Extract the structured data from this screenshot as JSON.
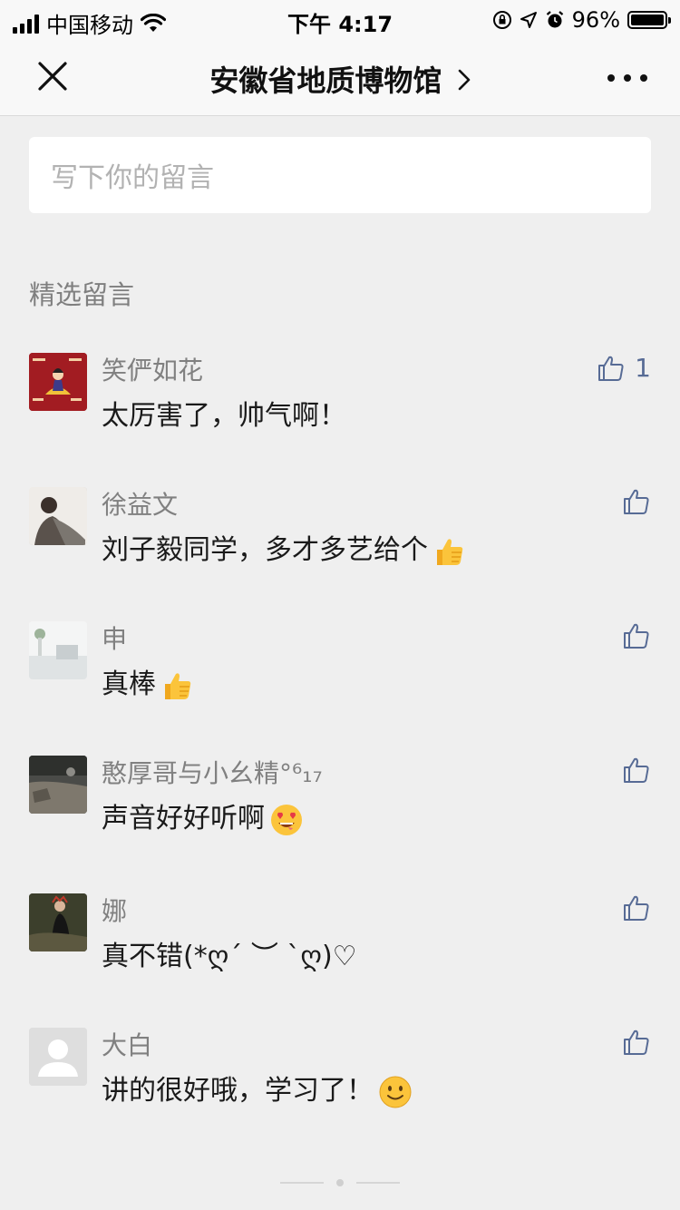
{
  "status_bar": {
    "carrier": "中国移动",
    "time": "下午 4:17",
    "battery": "96%"
  },
  "nav": {
    "title": "安徽省地质博物馆"
  },
  "input": {
    "placeholder": "写下你的留言"
  },
  "section_title": "精选留言",
  "comments": [
    {
      "name": "笑俨如花",
      "text": "太厉害了，帅气啊！",
      "likes": "1"
    },
    {
      "name": "徐益文",
      "text": "刘子毅同学，多才多艺给个"
    },
    {
      "name": "申",
      "text": "真棒"
    },
    {
      "name": "憨厚哥与小幺精",
      "name_suffix": "°⁶₁₇",
      "text": "声音好好听啊"
    },
    {
      "name": "娜",
      "text": "真不错(*ღ´ ︶ `ღ)♡"
    },
    {
      "name": "大白",
      "text": "讲的很好哦，学习了！"
    }
  ],
  "colors": {
    "link": "#576b95",
    "background": "#efefef",
    "name": "#808080"
  },
  "icons": {
    "like": "thumbs-up-icon",
    "close": "close-icon",
    "more": "more-icon"
  }
}
